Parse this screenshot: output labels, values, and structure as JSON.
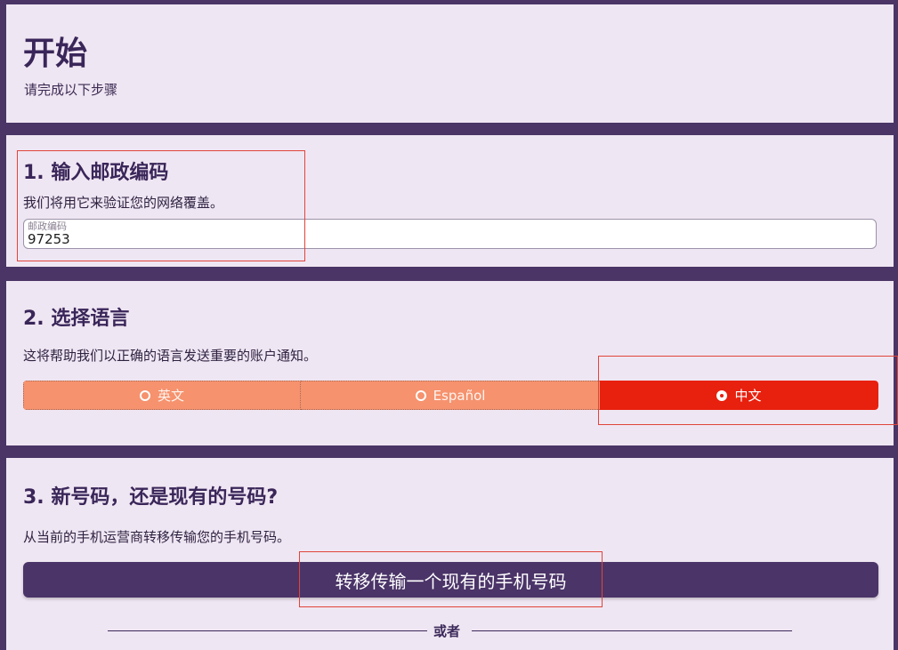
{
  "intro": {
    "title": "开始",
    "subtitle": "请完成以下步骤"
  },
  "step1": {
    "title": "1. 输入邮政编码",
    "description": "我们将用它来验证您的网络覆盖。",
    "zip_label": "邮政编码",
    "zip_value": "97253"
  },
  "step2": {
    "title": "2. 选择语言",
    "description": "这将帮助我们以正确的语言发送重要的账户通知。",
    "options": [
      {
        "label": "英文",
        "selected": false
      },
      {
        "label": "Español",
        "selected": false
      },
      {
        "label": "中文",
        "selected": true
      }
    ]
  },
  "step3": {
    "title": "3. 新号码，还是现有的号码?",
    "description": "从当前的手机运营商转移传输您的手机号码。",
    "port_button": "转移传输一个现有的手机号码",
    "or_text": "或者"
  },
  "colors": {
    "background": "#4a3566",
    "card": "#efe6f3",
    "segment": "#f6926e",
    "segment_selected": "#e8200e",
    "primary_button": "#4b3468"
  }
}
